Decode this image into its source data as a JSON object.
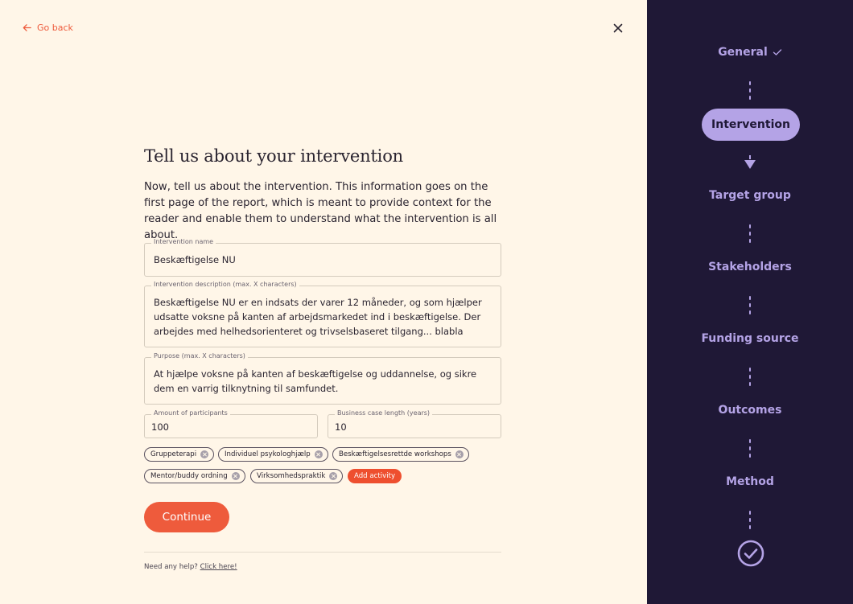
{
  "nav": {
    "go_back": "Go back"
  },
  "form": {
    "title": "Tell us about your intervention",
    "intro": "Now, tell us about the intervention. This information goes on the first page of the report, which is meant to provide context for the reader and enable them to understand what the intervention is all about.",
    "intervention_name": {
      "label": "Intervention name",
      "value": "Beskæftigelse NU"
    },
    "intervention_description": {
      "label": "Intervention description (max. X characters)",
      "lines": [
        "Beskæftigelse NU er  en indsats der varer 12 måneder, og som hjælper",
        "udsatte voksne på kanten af  arbejdsmarkedet ind i beskæftigelse. Der",
        "arbejdes med helhedsorienteret og  trivselsbaseret tilgang... blabla"
      ]
    },
    "purpose": {
      "label": "Purpose (max. X characters)",
      "lines": [
        "At hjælpe voksne på  kanten af beskæftigelse og uddannelse, og sikre",
        "dem en varrig tilknytning til  samfundet."
      ]
    },
    "participants": {
      "label": "Amount of participants",
      "value": "100"
    },
    "case_length": {
      "label": "Business case length (years)",
      "value": "10"
    },
    "activities": [
      "Gruppeterapi",
      "Individuel psykologhjælp",
      "Beskæftigelsesrettde workshops",
      "Mentor/buddy ordning",
      "Virksomhedspraktik"
    ],
    "add_activity": "Add activity",
    "continue": "Continue",
    "help_text": "Need any help?",
    "help_link": "Click here!"
  },
  "steps": [
    {
      "label": "General",
      "state": "done"
    },
    {
      "label": "Intervention",
      "state": "active"
    },
    {
      "label": "Target group",
      "state": "pending"
    },
    {
      "label": "Stakeholders",
      "state": "pending"
    },
    {
      "label": "Funding source",
      "state": "pending"
    },
    {
      "label": "Outcomes",
      "state": "pending"
    },
    {
      "label": "Method",
      "state": "pending"
    }
  ],
  "colors": {
    "accent": "#ee5b3c",
    "background": "#fff6e8",
    "sidebar": "#1f1836",
    "sidebar_accent": "#b4a3e6"
  }
}
